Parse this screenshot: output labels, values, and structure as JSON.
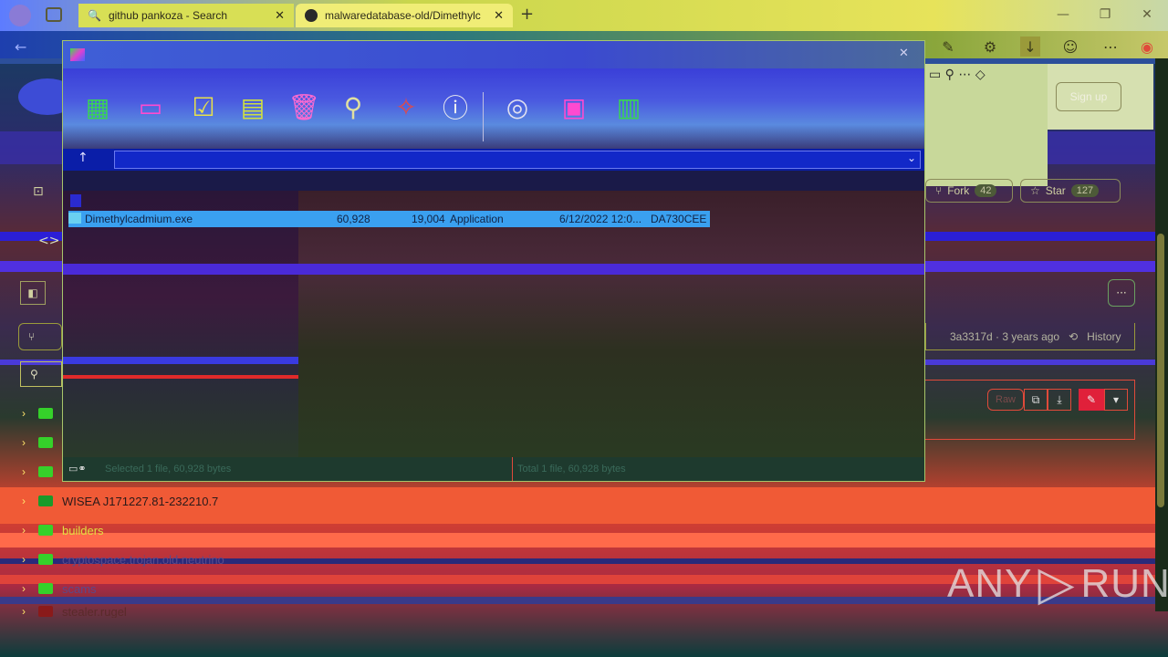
{
  "browser": {
    "tabs": [
      {
        "label": "github pankoza - Search",
        "icon": "search-icon"
      },
      {
        "label": "malwaredatabase-old/Dimethylc",
        "icon": "github-icon"
      }
    ],
    "new_tab": "+",
    "window_controls": {
      "minimize": "—",
      "restore": "❐",
      "close": "✕"
    }
  },
  "github": {
    "sign_up": "Sign up",
    "fork_label": "Fork",
    "fork_count": "42",
    "star_label": "Star",
    "star_count": "127",
    "more": "···",
    "commit": "3a3317d · 3 years ago",
    "history": "History",
    "raw": "Raw",
    "tree": [
      {
        "label": ""
      },
      {
        "label": ""
      },
      {
        "label": ""
      },
      {
        "label": "WISEA J171227.81-232210.7"
      },
      {
        "label": "builders"
      },
      {
        "label": "cryptospace.trojan.old.neutrino"
      },
      {
        "label": "scams"
      },
      {
        "label": "stealer.rugel"
      }
    ]
  },
  "explorer": {
    "close": "✕",
    "up_arrow": "↑",
    "dropdown": "⌄",
    "file": {
      "name": "Dimethylcadmium.exe",
      "size": "60,928",
      "packed": "19,004",
      "type": "Application",
      "modified": "6/12/2022 12:0...",
      "crc": "DA730CEE"
    },
    "status_left": "Selected 1 file, 60,928 bytes",
    "status_right": "Total 1 file, 60,928 bytes"
  },
  "watermark": {
    "left": "ANY",
    "right": "RUN"
  }
}
